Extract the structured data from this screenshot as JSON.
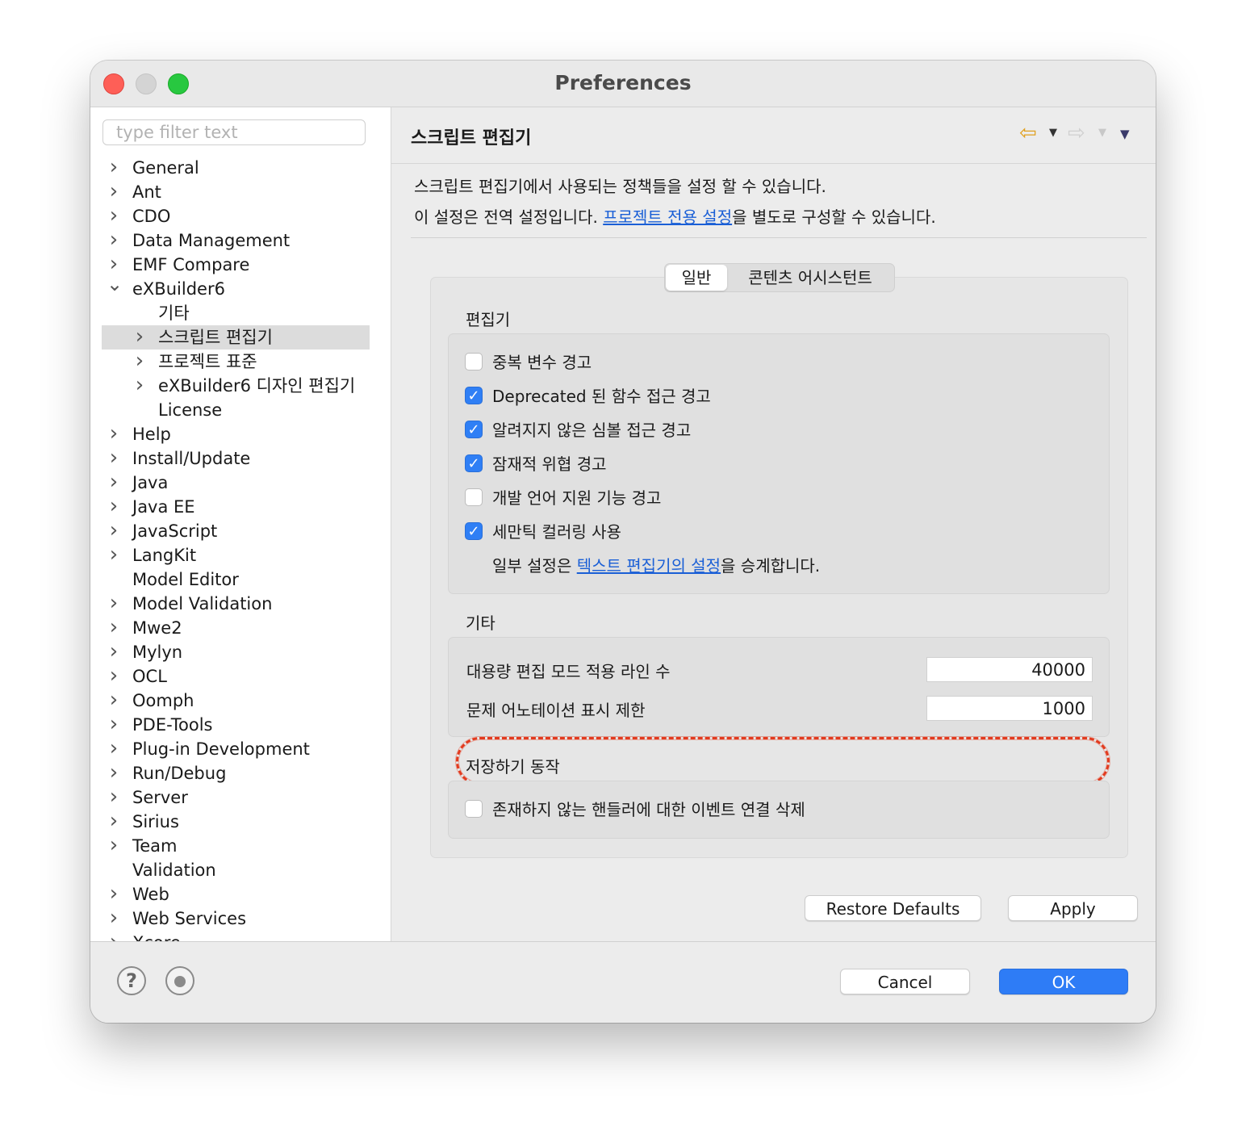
{
  "window": {
    "title": "Preferences"
  },
  "sidebar": {
    "filter_placeholder": "type filter text",
    "items": [
      {
        "label": "General",
        "expander": "collapsed"
      },
      {
        "label": "Ant",
        "expander": "collapsed"
      },
      {
        "label": "CDO",
        "expander": "collapsed"
      },
      {
        "label": "Data Management",
        "expander": "collapsed"
      },
      {
        "label": "EMF Compare",
        "expander": "collapsed"
      },
      {
        "label": "eXBuilder6",
        "expander": "expanded"
      },
      {
        "label": "기타",
        "expander": "none"
      },
      {
        "label": "스크립트 편집기",
        "expander": "collapsed",
        "selected": true
      },
      {
        "label": "프로젝트 표준",
        "expander": "collapsed"
      },
      {
        "label": "eXBuilder6 디자인 편집기",
        "expander": "collapsed"
      },
      {
        "label": "License",
        "expander": "none"
      },
      {
        "label": "Help",
        "expander": "collapsed"
      },
      {
        "label": "Install/Update",
        "expander": "collapsed"
      },
      {
        "label": "Java",
        "expander": "collapsed"
      },
      {
        "label": "Java EE",
        "expander": "collapsed"
      },
      {
        "label": "JavaScript",
        "expander": "collapsed"
      },
      {
        "label": "LangKit",
        "expander": "collapsed"
      },
      {
        "label": "Model Editor",
        "expander": "none"
      },
      {
        "label": "Model Validation",
        "expander": "collapsed"
      },
      {
        "label": "Mwe2",
        "expander": "collapsed"
      },
      {
        "label": "Mylyn",
        "expander": "collapsed"
      },
      {
        "label": "OCL",
        "expander": "collapsed"
      },
      {
        "label": "Oomph",
        "expander": "collapsed"
      },
      {
        "label": "PDE-Tools",
        "expander": "collapsed"
      },
      {
        "label": "Plug-in Development",
        "expander": "collapsed"
      },
      {
        "label": "Run/Debug",
        "expander": "collapsed"
      },
      {
        "label": "Server",
        "expander": "collapsed"
      },
      {
        "label": "Sirius",
        "expander": "collapsed"
      },
      {
        "label": "Team",
        "expander": "collapsed"
      },
      {
        "label": "Validation",
        "expander": "none"
      },
      {
        "label": "Web",
        "expander": "collapsed"
      },
      {
        "label": "Web Services",
        "expander": "collapsed"
      },
      {
        "label": "Xcore",
        "expander": "collapsed"
      }
    ]
  },
  "page": {
    "title": "스크립트 편집기",
    "desc_line1": "스크립트 편집기에서 사용되는 정책들을 설정 할 수 있습니다.",
    "desc_line2_prefix": "이 설정은 전역 설정입니다. ",
    "desc_line2_link": "프로젝트 전용 설정",
    "desc_line2_suffix": "을 별도로 구성할 수 있습니다.",
    "nav": {
      "back_icon": "arrow-left-icon",
      "forward_icon": "arrow-right-icon",
      "menu_icon": "triangle-down-icon"
    }
  },
  "tabs": {
    "general": "일반",
    "content_assist": "콘텐츠 어시스턴트"
  },
  "editor_section": {
    "title": "편집기",
    "options": [
      {
        "label": "중복 변수 경고",
        "checked": false
      },
      {
        "label": "Deprecated 된 함수 접근 경고",
        "checked": true
      },
      {
        "label": "알려지지 않은 심볼 접근 경고",
        "checked": true
      },
      {
        "label": "잠재적 위협 경고",
        "checked": true
      },
      {
        "label": "개발 언어 지원 기능 경고",
        "checked": false
      },
      {
        "label": "세만틱 컬러링 사용",
        "checked": true
      }
    ],
    "note_prefix": "일부 설정은 ",
    "note_link": "텍스트 편집기의 설정",
    "note_suffix": "을 승계합니다."
  },
  "other_section": {
    "title": "기타",
    "large_edit_label": "대용량 편집 모드 적용 라인 수",
    "large_edit_value": "40000",
    "annotation_limit_label": "문제 어노테이션 표시 제한",
    "annotation_limit_value": "1000"
  },
  "save_section": {
    "title": "저장하기 동작",
    "option": {
      "label": "존재하지 않는 핸들러에 대한 이벤트 연결 삭제",
      "checked": false
    }
  },
  "buttons": {
    "restore_defaults": "Restore Defaults",
    "apply": "Apply",
    "cancel": "Cancel",
    "ok": "OK"
  },
  "footer_icons": {
    "help": "?",
    "help_icon": "help-icon",
    "record_icon": "record-icon"
  },
  "colors": {
    "accent": "#2e7cf6",
    "highlight": "#e23a1e",
    "link": "#1a5fd6"
  }
}
